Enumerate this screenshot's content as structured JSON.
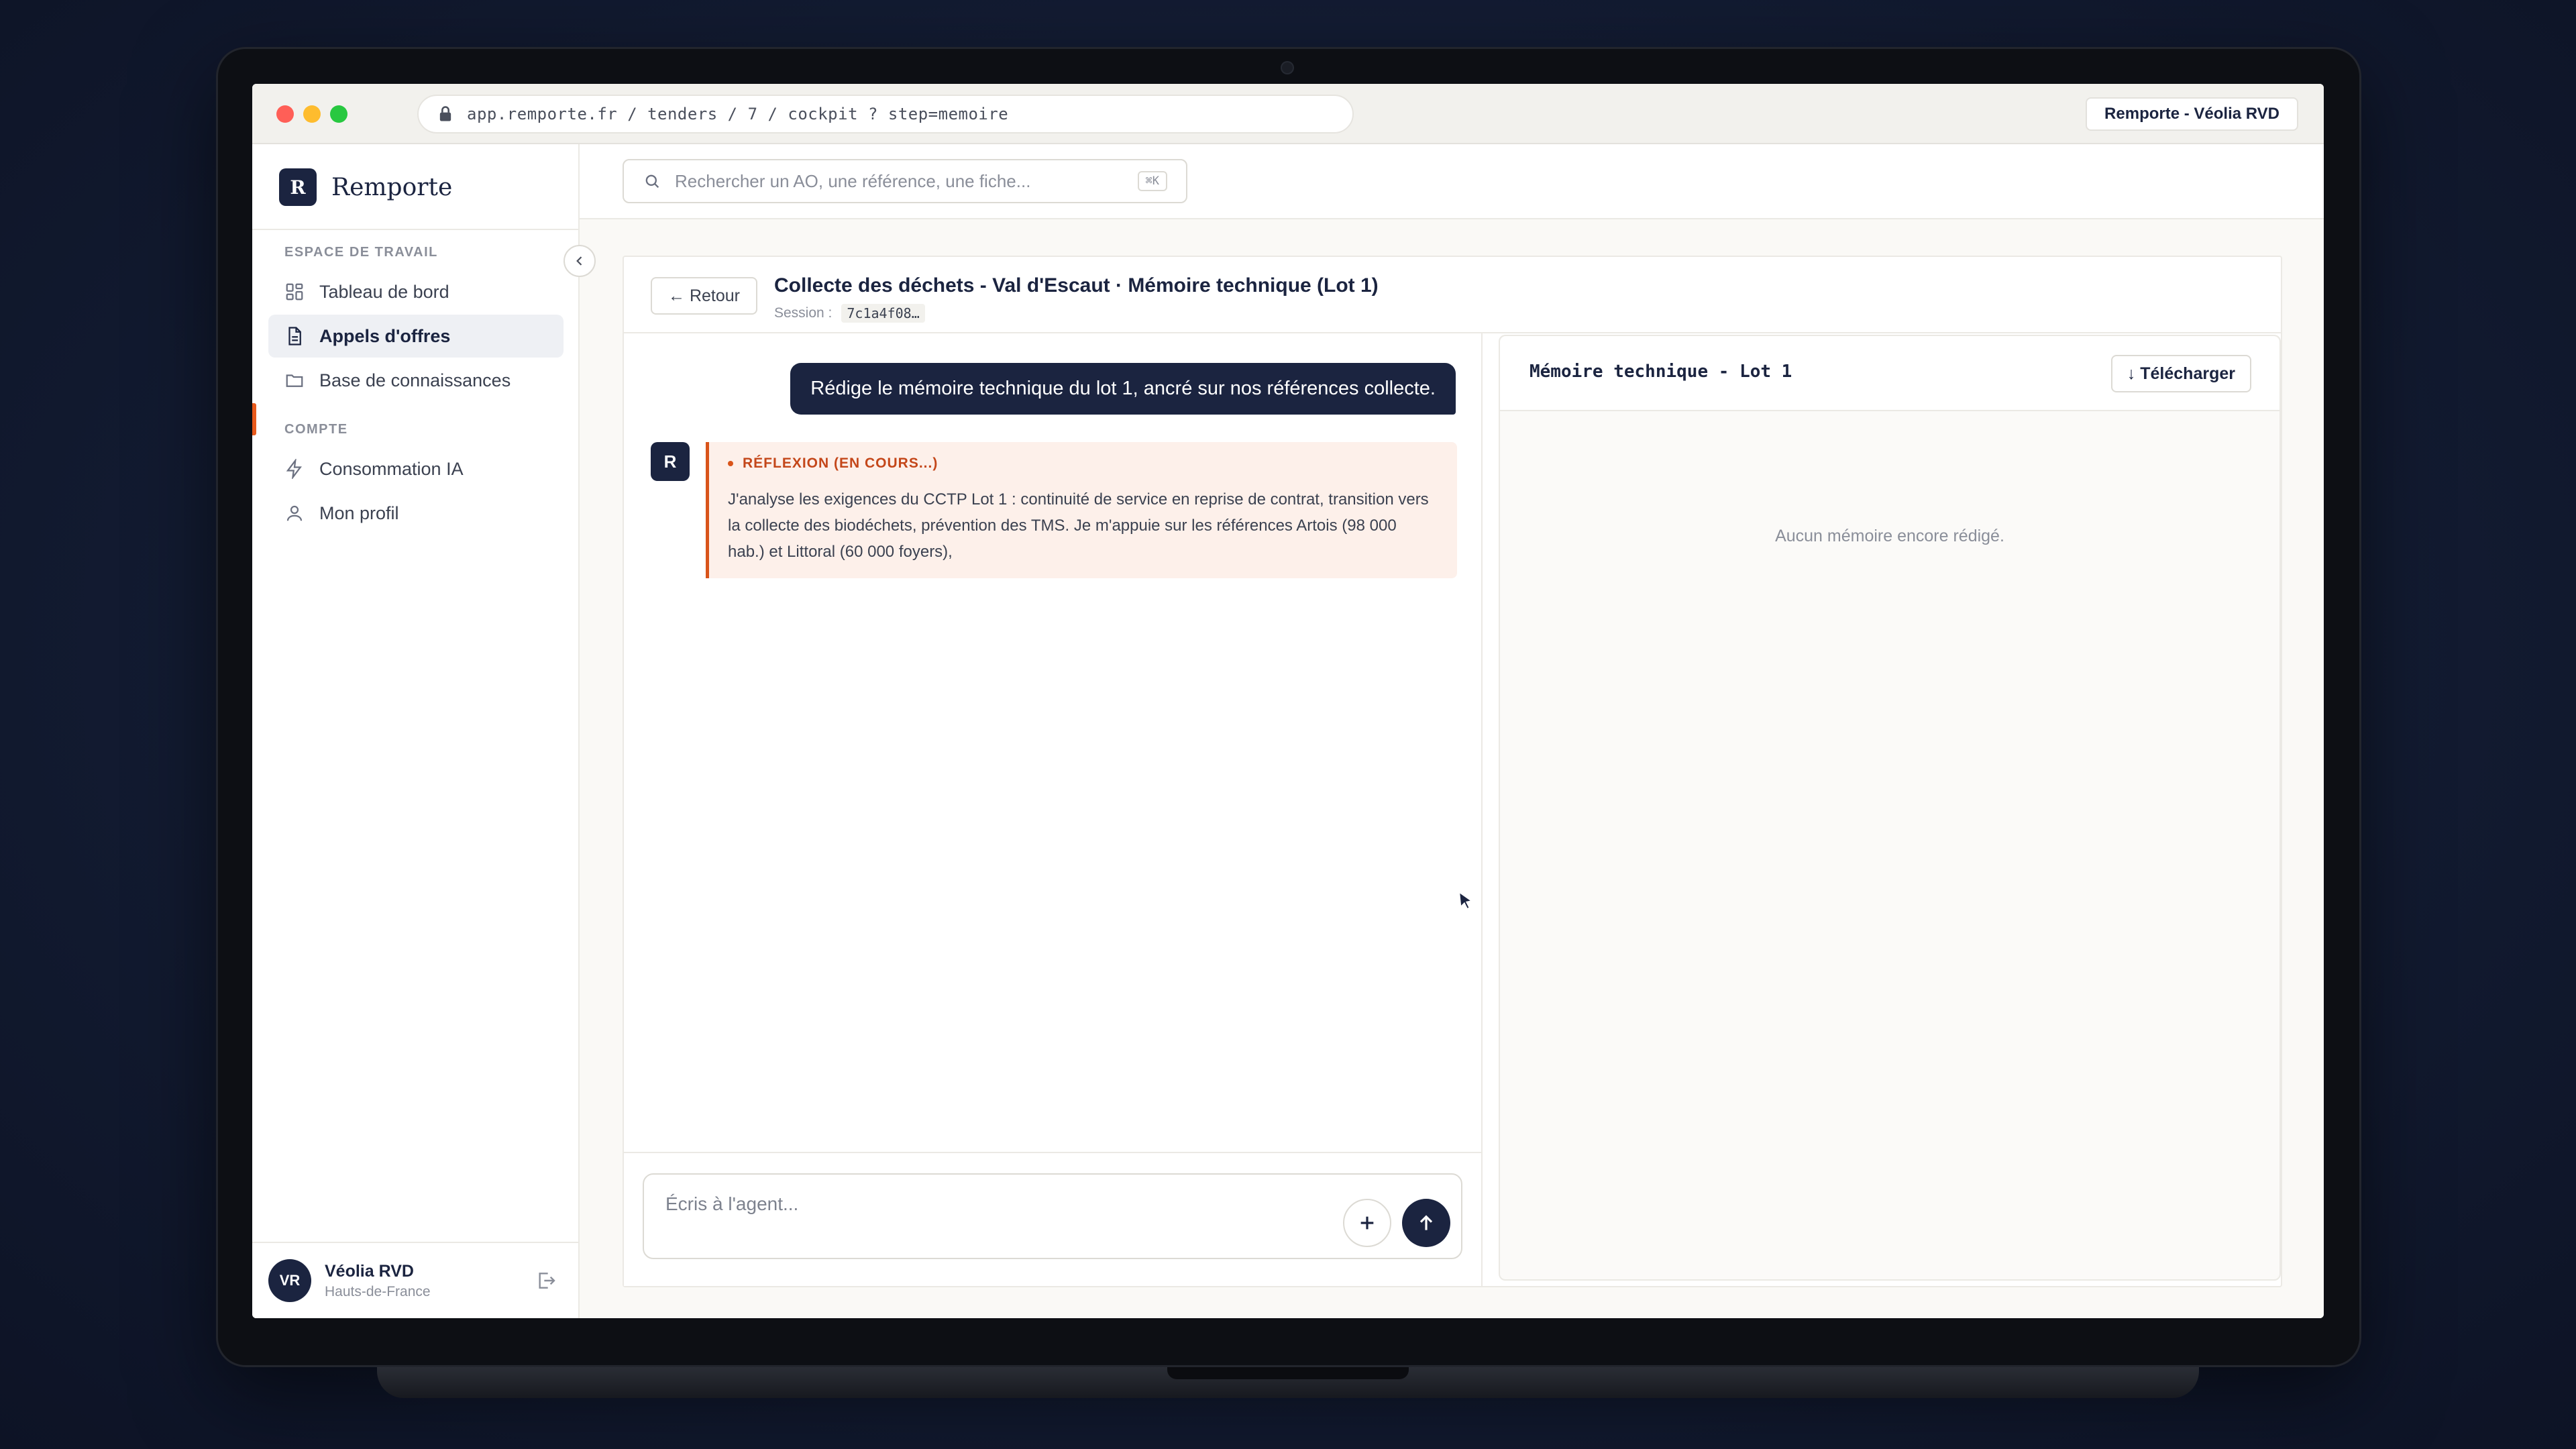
{
  "browser": {
    "url": "app.remporte.fr / tenders / 7 / cockpit ? step=memoire",
    "tenant": "Remporte - Véolia RVD"
  },
  "sidebar": {
    "brand_initial": "R",
    "brand_name": "Remporte",
    "workspace_label": "ESPACE DE TRAVAIL",
    "workspace_items": [
      {
        "label": "Tableau de bord",
        "icon": "grid-icon"
      },
      {
        "label": "Appels d'offres",
        "icon": "document-icon",
        "active": true
      },
      {
        "label": "Base de connaissances",
        "icon": "folder-icon"
      }
    ],
    "account_label": "COMPTE",
    "account_items": [
      {
        "label": "Consommation IA",
        "icon": "lightning-icon"
      },
      {
        "label": "Mon profil",
        "icon": "user-icon"
      }
    ],
    "user": {
      "initials": "VR",
      "name": "Véolia RVD",
      "region": "Hauts-de-France"
    }
  },
  "topbar": {
    "search_placeholder": "Rechercher un AO, une référence, une fiche...",
    "shortcut": "⌘K"
  },
  "workspace": {
    "back_label": "← Retour",
    "title": "Collecte des déchets - Val d'Escaut · Mémoire technique (Lot 1)",
    "session_label": "Session :",
    "session_id": "7c1a4f08…"
  },
  "chat": {
    "user_message": "Rédige le mémoire technique du lot 1, ancré sur nos références collecte.",
    "agent_initial": "R",
    "reflection_label": "RÉFLEXION (EN COURS...)",
    "reflection_text": "J'analyse les exigences du CCTP Lot 1 : continuité de service en reprise de contrat, transition vers la collecte des biodéchets, prévention des TMS. Je m'appuie sur les références Artois (98 000 hab.) et Littoral (60 000 foyers),",
    "composer_placeholder": "Écris à l'agent..."
  },
  "doc_panel": {
    "title": "Mémoire technique - Lot 1",
    "download_label": "↓ Télécharger",
    "empty_text": "Aucun mémoire encore rédigé."
  },
  "colors": {
    "navy": "#1b2440",
    "accent": "#e85a1c",
    "reflection_bg": "#fdf0ea"
  }
}
